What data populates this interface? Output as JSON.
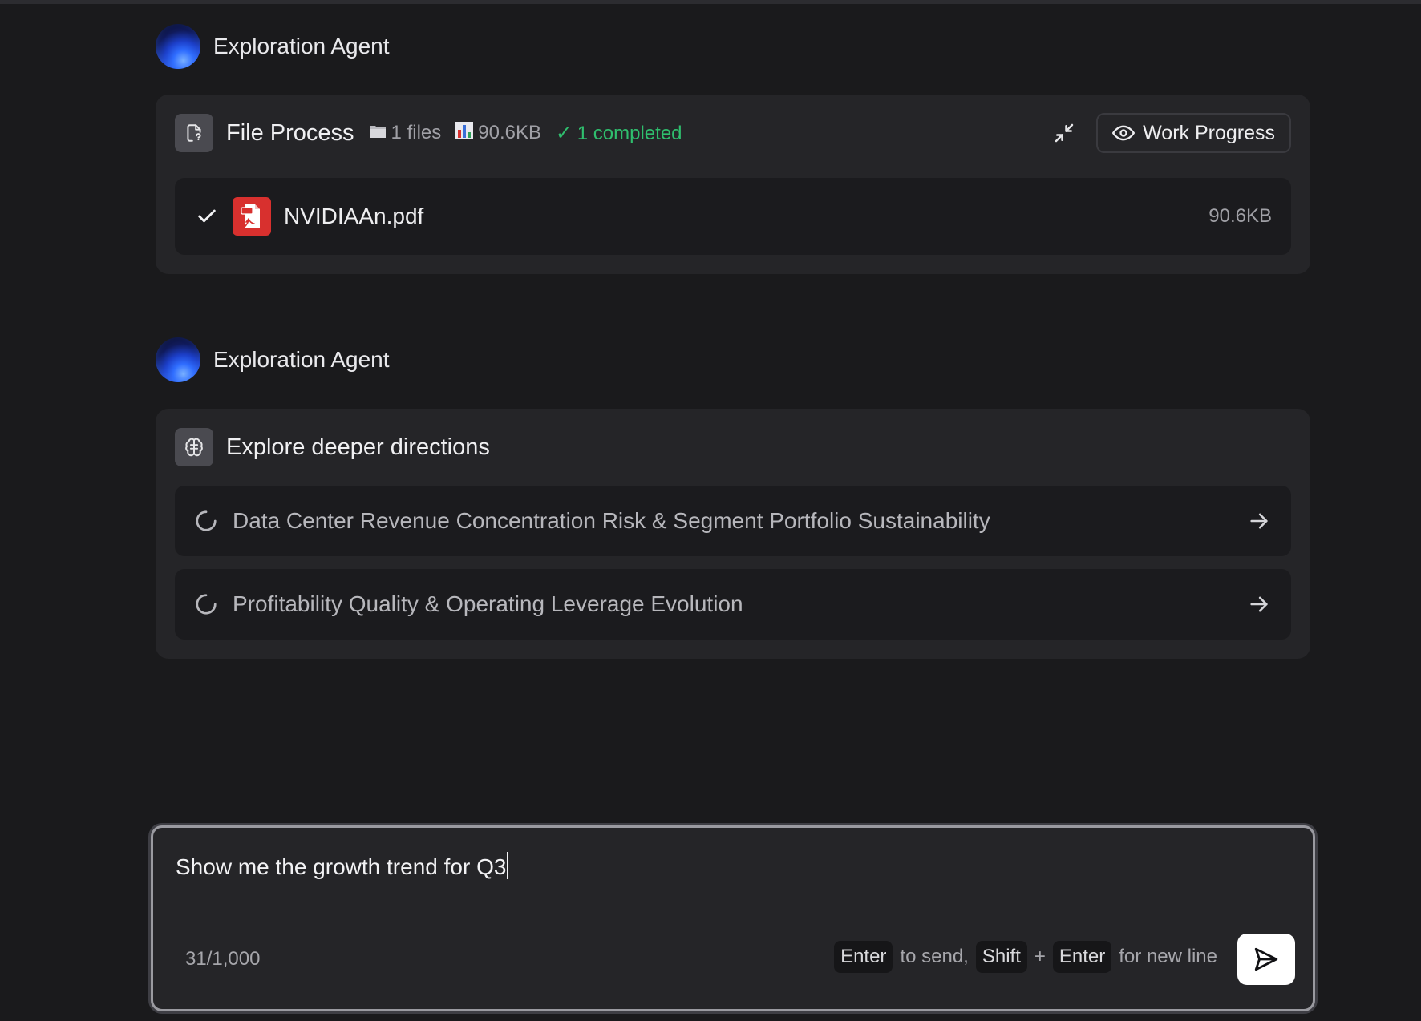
{
  "agent": {
    "name": "Exploration Agent"
  },
  "file_process": {
    "title": "File Process",
    "files_count": "1 files",
    "total_size": "90.6KB",
    "completed": "✓ 1 completed",
    "work_progress_label": "Work Progress",
    "files": [
      {
        "name": "NVIDIAAn.pdf",
        "size": "90.6KB",
        "status": "done"
      }
    ]
  },
  "explore": {
    "title": "Explore deeper directions",
    "directions": [
      {
        "label": "Data Center Revenue Concentration Risk & Segment Portfolio Sustainability"
      },
      {
        "label": "Profitability Quality & Operating Leverage Evolution"
      }
    ]
  },
  "composer": {
    "value": "Show me the growth trend for Q3",
    "char_count": "31/1,000",
    "hint": {
      "key_enter": "Enter",
      "to_send": "to send,",
      "key_shift": "Shift",
      "plus": "+",
      "key_enter2": "Enter",
      "new_line": "for new line"
    }
  },
  "colors": {
    "background": "#1a1a1c",
    "card": "#252528",
    "row": "#1b1b1e",
    "success": "#2fbf6e",
    "pdf": "#d8302e"
  },
  "icons": {
    "file_process": "file-scan-icon",
    "files": "folder-icon",
    "size": "bar-chart-icon",
    "collapse": "minimize-icon",
    "work_progress": "eye-icon",
    "explore": "brain-icon",
    "direction_status": "loading-spinner-icon",
    "direction_go": "arrow-right-icon",
    "send": "send-icon"
  }
}
